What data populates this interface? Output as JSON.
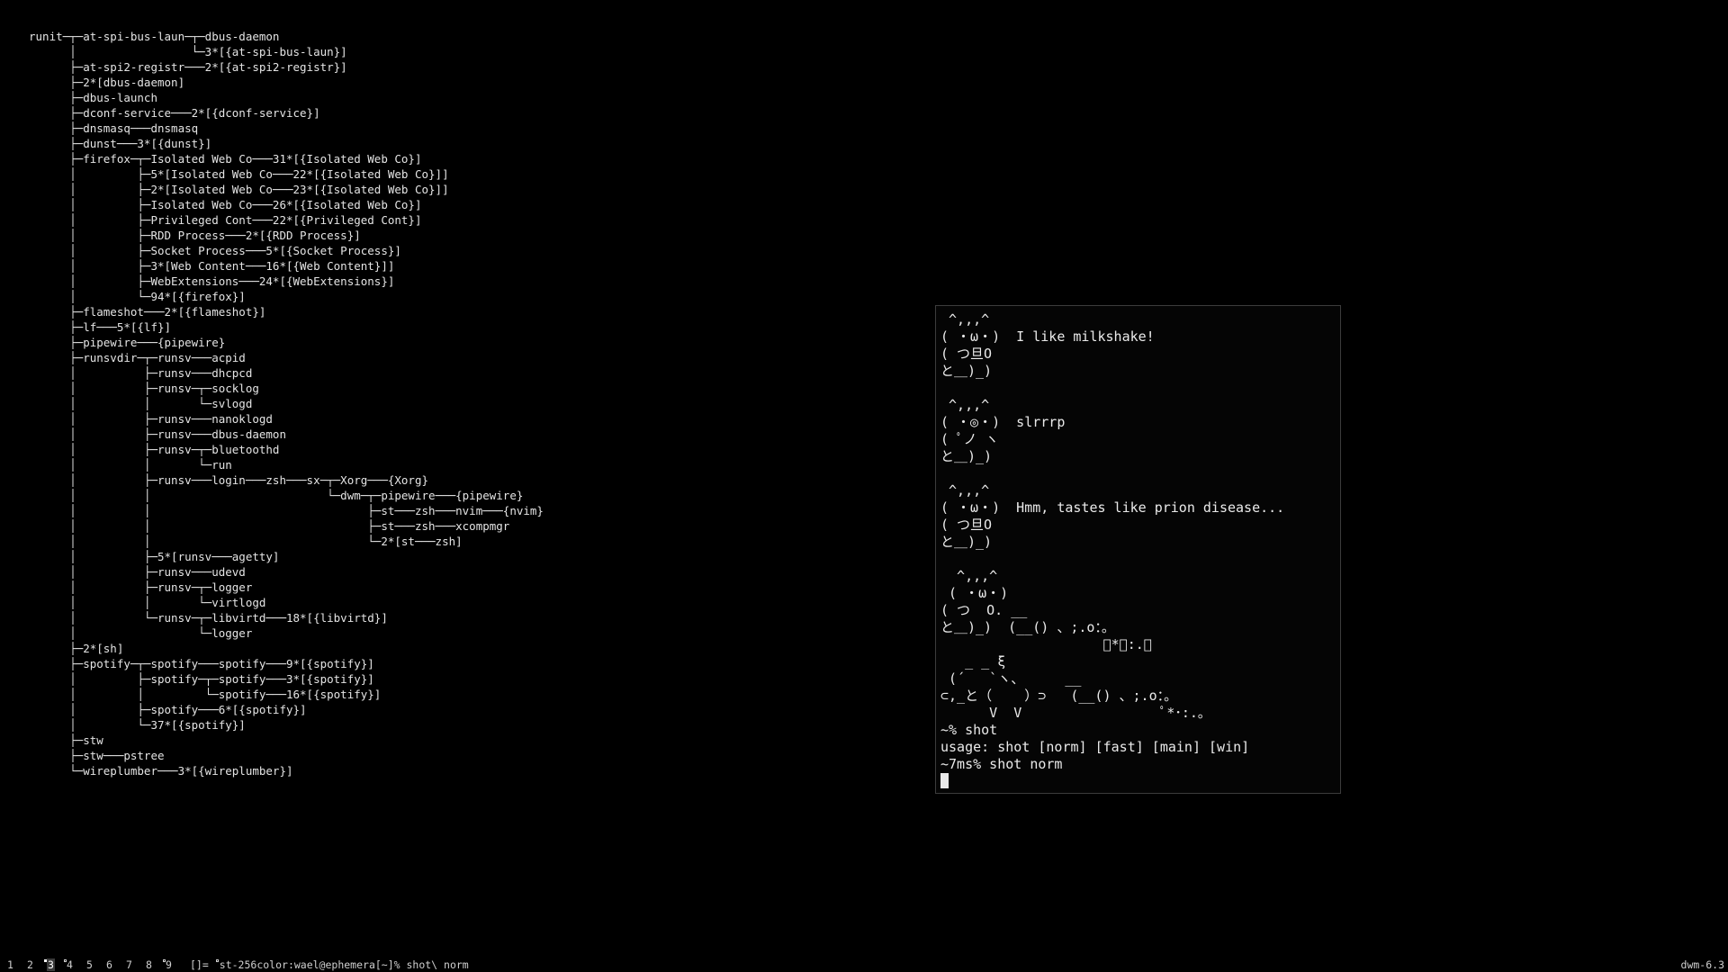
{
  "pstree": {
    "lines": [
      "runit─┬─at-spi-bus-laun─┬─dbus-daemon",
      "      │                 └─3*[{at-spi-bus-laun}]",
      "      ├─at-spi2-registr───2*[{at-spi2-registr}]",
      "      ├─2*[dbus-daemon]",
      "      ├─dbus-launch",
      "      ├─dconf-service───2*[{dconf-service}]",
      "      ├─dnsmasq───dnsmasq",
      "      ├─dunst───3*[{dunst}]",
      "      ├─firefox─┬─Isolated Web Co───31*[{Isolated Web Co}]",
      "      │         ├─5*[Isolated Web Co───22*[{Isolated Web Co}]]",
      "      │         ├─2*[Isolated Web Co───23*[{Isolated Web Co}]]",
      "      │         ├─Isolated Web Co───26*[{Isolated Web Co}]",
      "      │         ├─Privileged Cont───22*[{Privileged Cont}]",
      "      │         ├─RDD Process───2*[{RDD Process}]",
      "      │         ├─Socket Process───5*[{Socket Process}]",
      "      │         ├─3*[Web Content───16*[{Web Content}]]",
      "      │         ├─WebExtensions───24*[{WebExtensions}]",
      "      │         └─94*[{firefox}]",
      "      ├─flameshot───2*[{flameshot}]",
      "      ├─lf───5*[{lf}]",
      "      ├─pipewire───{pipewire}",
      "      ├─runsvdir─┬─runsv───acpid",
      "      │          ├─runsv───dhcpcd",
      "      │          ├─runsv─┬─socklog",
      "      │          │       └─svlogd",
      "      │          ├─runsv───nanoklogd",
      "      │          ├─runsv───dbus-daemon",
      "      │          ├─runsv─┬─bluetoothd",
      "      │          │       └─run",
      "      │          ├─runsv───login───zsh───sx─┬─Xorg───{Xorg}",
      "      │          │                          └─dwm─┬─pipewire───{pipewire}",
      "      │          │                                ├─st───zsh───nvim───{nvim}",
      "      │          │                                ├─st───zsh───xcompmgr",
      "      │          │                                └─2*[st───zsh]",
      "      │          ├─5*[runsv───agetty]",
      "      │          ├─runsv───udevd",
      "      │          ├─runsv─┬─logger",
      "      │          │       └─virtlogd",
      "      │          └─runsv─┬─libvirtd───18*[{libvirtd}]",
      "      │                  └─logger",
      "      ├─2*[sh]",
      "      ├─spotify─┬─spotify───spotify───9*[{spotify}]",
      "      │         ├─spotify─┬─spotify───3*[{spotify}]",
      "      │         │         └─spotify───16*[{spotify}]",
      "      │         ├─spotify───6*[{spotify}]",
      "      │         └─37*[{spotify}]",
      "      ├─stw",
      "      ├─stw───pstree",
      "      └─wireplumber───3*[{wireplumber}]"
    ]
  },
  "terminal": {
    "lines": [
      " ^,,,^",
      "( ・ω・)  I like milkshake!",
      "( つ旦O",
      "と＿)_)",
      "",
      " ^,,,^",
      "( ・◎・)  slrrrp",
      "( ﾟノ ヽ",
      "と＿)_)",
      "",
      " ^,,,^",
      "( ・ω・)  Hmm, tastes like prion disease...",
      "( つ旦O",
      "と＿)_)",
      "",
      "  ^,,,^",
      " ( ・ω・)",
      "( つ  O. __",
      "と＿)_)  (__() 、;.o：。",
      "                    ﾟ*･:.｡",
      "   _ _ ξ",
      " (´   `ヽ、     __",
      "⊂,_と（    ）⊃   (__() 、;.o：。",
      "      V  V                 ﾟ*･:.｡",
      "~% shot",
      "usage: shot [norm] [fast] [main] [win]",
      "~7ms% shot norm"
    ]
  },
  "statusbar": {
    "tags": [
      {
        "label": "1",
        "occupied": false,
        "selected": false
      },
      {
        "label": "2",
        "occupied": false,
        "selected": false
      },
      {
        "label": "3",
        "occupied": true,
        "selected": true
      },
      {
        "label": "4",
        "occupied": true,
        "selected": false
      },
      {
        "label": "5",
        "occupied": false,
        "selected": false
      },
      {
        "label": "6",
        "occupied": false,
        "selected": false
      },
      {
        "label": "7",
        "occupied": false,
        "selected": false
      },
      {
        "label": "8",
        "occupied": false,
        "selected": false
      },
      {
        "label": "9",
        "occupied": true,
        "selected": false
      }
    ],
    "layout_symbol": "[]=",
    "window_title": "st-256color:wael@ephemera[~]% shot\\ norm",
    "status_text": "dwm-6.3"
  }
}
